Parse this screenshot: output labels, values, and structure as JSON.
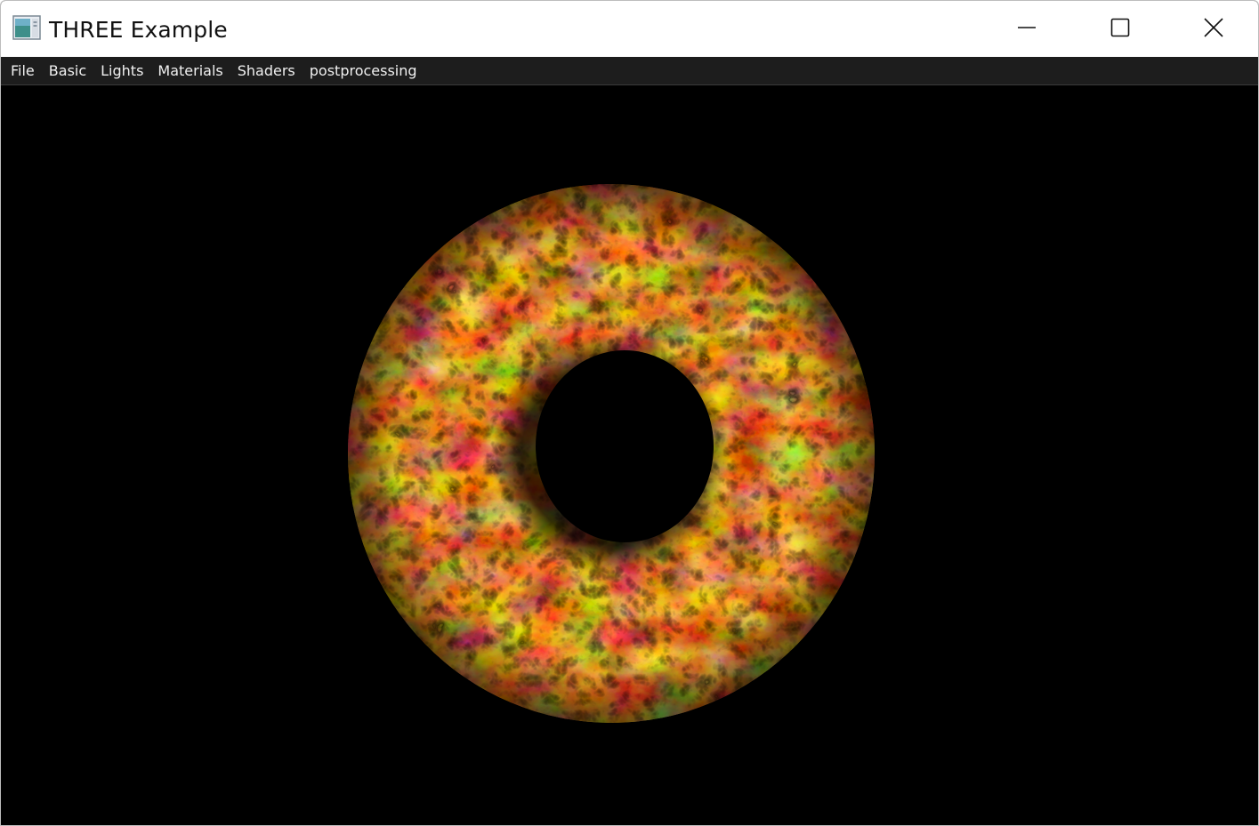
{
  "window": {
    "title": "THREE Example",
    "icon": "app-window-icon"
  },
  "titlebar_controls": {
    "minimize_icon": "minimize-icon",
    "maximize_icon": "maximize-icon",
    "close_icon": "close-icon"
  },
  "menu": {
    "items": [
      {
        "label": "File"
      },
      {
        "label": "Basic"
      },
      {
        "label": "Lights"
      },
      {
        "label": "Materials"
      },
      {
        "label": "Shaders"
      },
      {
        "label": "postprocessing"
      }
    ]
  },
  "scene": {
    "background_color": "#000000",
    "object": "lava-textured-torus",
    "colors": {
      "dark": "#2a0800",
      "mid": "#b3360a",
      "bright": "#ff8c1a",
      "highlight": "#ffe27a"
    }
  }
}
